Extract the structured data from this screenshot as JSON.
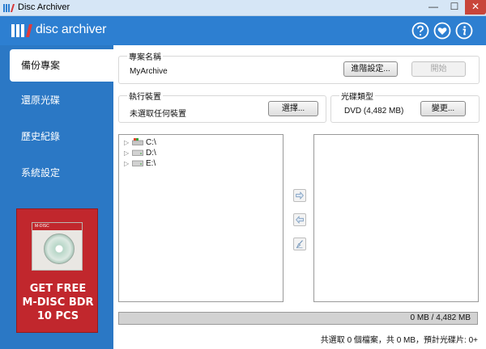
{
  "window": {
    "title": "Disc Archiver",
    "min_glyph": "—",
    "max_glyph": "☐",
    "close_glyph": "✕"
  },
  "header": {
    "logo_text": "disc archiver",
    "icons": [
      "help-icon",
      "heart-icon",
      "info-icon"
    ],
    "accent_color": "#2d7fd1"
  },
  "sidebar": {
    "items": [
      {
        "label": "備份專案",
        "active": true
      },
      {
        "label": "還原光碟",
        "active": false
      },
      {
        "label": "歷史紀錄",
        "active": false
      },
      {
        "label": "系統設定",
        "active": false
      }
    ],
    "ad": {
      "box_brand": "M-DISC",
      "lines": [
        "GET FREE",
        "M-DISC BDR",
        "10 PCS"
      ]
    }
  },
  "project": {
    "label": "專案名稱",
    "value": "MyArchive",
    "advanced_button": "進階設定...",
    "start_button": "開始"
  },
  "device": {
    "label": "執行裝置",
    "value": "未選取任何裝置",
    "select_button": "選擇..."
  },
  "disc_type": {
    "label": "光碟類型",
    "value": "DVD (4,482 MB)",
    "change_button": "變更..."
  },
  "file_tree": {
    "drives": [
      "C:\\",
      "D:\\",
      "E:\\"
    ]
  },
  "progress": {
    "text": "0 MB / 4,482 MB",
    "fraction": 0.0
  },
  "status_line": "共選取 0 個檔案，共 0 MB，預計光碟片: 0+"
}
